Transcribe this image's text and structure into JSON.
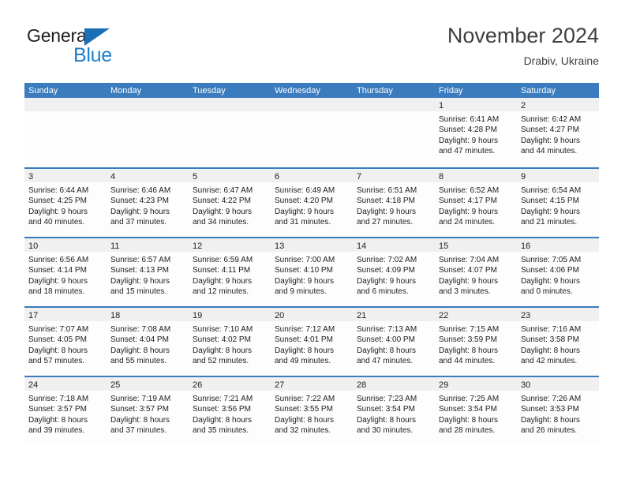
{
  "brand": {
    "name_part1": "General",
    "name_part2": "Blue",
    "logo_icon": "triangle-logo-icon",
    "colors": {
      "blue": "#1a7fd0",
      "triangle_blue": "#1a6fb5",
      "dark": "#231f20"
    }
  },
  "header": {
    "title": "November 2024",
    "subtitle": "Drabiv, Ukraine"
  },
  "theme": {
    "header_blue": "#3a7cbe",
    "daynum_band": "#f0f0f0",
    "cell_background": "#fdfdfd",
    "text": "#1d1d1d"
  },
  "calendar": {
    "weekdays": [
      "Sunday",
      "Monday",
      "Tuesday",
      "Wednesday",
      "Thursday",
      "Friday",
      "Saturday"
    ],
    "weeks": [
      [
        {
          "day": "",
          "lines": []
        },
        {
          "day": "",
          "lines": []
        },
        {
          "day": "",
          "lines": []
        },
        {
          "day": "",
          "lines": []
        },
        {
          "day": "",
          "lines": []
        },
        {
          "day": "1",
          "lines": [
            "Sunrise: 6:41 AM",
            "Sunset: 4:28 PM",
            "Daylight: 9 hours",
            "and 47 minutes."
          ]
        },
        {
          "day": "2",
          "lines": [
            "Sunrise: 6:42 AM",
            "Sunset: 4:27 PM",
            "Daylight: 9 hours",
            "and 44 minutes."
          ]
        }
      ],
      [
        {
          "day": "3",
          "lines": [
            "Sunrise: 6:44 AM",
            "Sunset: 4:25 PM",
            "Daylight: 9 hours",
            "and 40 minutes."
          ]
        },
        {
          "day": "4",
          "lines": [
            "Sunrise: 6:46 AM",
            "Sunset: 4:23 PM",
            "Daylight: 9 hours",
            "and 37 minutes."
          ]
        },
        {
          "day": "5",
          "lines": [
            "Sunrise: 6:47 AM",
            "Sunset: 4:22 PM",
            "Daylight: 9 hours",
            "and 34 minutes."
          ]
        },
        {
          "day": "6",
          "lines": [
            "Sunrise: 6:49 AM",
            "Sunset: 4:20 PM",
            "Daylight: 9 hours",
            "and 31 minutes."
          ]
        },
        {
          "day": "7",
          "lines": [
            "Sunrise: 6:51 AM",
            "Sunset: 4:18 PM",
            "Daylight: 9 hours",
            "and 27 minutes."
          ]
        },
        {
          "day": "8",
          "lines": [
            "Sunrise: 6:52 AM",
            "Sunset: 4:17 PM",
            "Daylight: 9 hours",
            "and 24 minutes."
          ]
        },
        {
          "day": "9",
          "lines": [
            "Sunrise: 6:54 AM",
            "Sunset: 4:15 PM",
            "Daylight: 9 hours",
            "and 21 minutes."
          ]
        }
      ],
      [
        {
          "day": "10",
          "lines": [
            "Sunrise: 6:56 AM",
            "Sunset: 4:14 PM",
            "Daylight: 9 hours",
            "and 18 minutes."
          ]
        },
        {
          "day": "11",
          "lines": [
            "Sunrise: 6:57 AM",
            "Sunset: 4:13 PM",
            "Daylight: 9 hours",
            "and 15 minutes."
          ]
        },
        {
          "day": "12",
          "lines": [
            "Sunrise: 6:59 AM",
            "Sunset: 4:11 PM",
            "Daylight: 9 hours",
            "and 12 minutes."
          ]
        },
        {
          "day": "13",
          "lines": [
            "Sunrise: 7:00 AM",
            "Sunset: 4:10 PM",
            "Daylight: 9 hours",
            "and 9 minutes."
          ]
        },
        {
          "day": "14",
          "lines": [
            "Sunrise: 7:02 AM",
            "Sunset: 4:09 PM",
            "Daylight: 9 hours",
            "and 6 minutes."
          ]
        },
        {
          "day": "15",
          "lines": [
            "Sunrise: 7:04 AM",
            "Sunset: 4:07 PM",
            "Daylight: 9 hours",
            "and 3 minutes."
          ]
        },
        {
          "day": "16",
          "lines": [
            "Sunrise: 7:05 AM",
            "Sunset: 4:06 PM",
            "Daylight: 9 hours",
            "and 0 minutes."
          ]
        }
      ],
      [
        {
          "day": "17",
          "lines": [
            "Sunrise: 7:07 AM",
            "Sunset: 4:05 PM",
            "Daylight: 8 hours",
            "and 57 minutes."
          ]
        },
        {
          "day": "18",
          "lines": [
            "Sunrise: 7:08 AM",
            "Sunset: 4:04 PM",
            "Daylight: 8 hours",
            "and 55 minutes."
          ]
        },
        {
          "day": "19",
          "lines": [
            "Sunrise: 7:10 AM",
            "Sunset: 4:02 PM",
            "Daylight: 8 hours",
            "and 52 minutes."
          ]
        },
        {
          "day": "20",
          "lines": [
            "Sunrise: 7:12 AM",
            "Sunset: 4:01 PM",
            "Daylight: 8 hours",
            "and 49 minutes."
          ]
        },
        {
          "day": "21",
          "lines": [
            "Sunrise: 7:13 AM",
            "Sunset: 4:00 PM",
            "Daylight: 8 hours",
            "and 47 minutes."
          ]
        },
        {
          "day": "22",
          "lines": [
            "Sunrise: 7:15 AM",
            "Sunset: 3:59 PM",
            "Daylight: 8 hours",
            "and 44 minutes."
          ]
        },
        {
          "day": "23",
          "lines": [
            "Sunrise: 7:16 AM",
            "Sunset: 3:58 PM",
            "Daylight: 8 hours",
            "and 42 minutes."
          ]
        }
      ],
      [
        {
          "day": "24",
          "lines": [
            "Sunrise: 7:18 AM",
            "Sunset: 3:57 PM",
            "Daylight: 8 hours",
            "and 39 minutes."
          ]
        },
        {
          "day": "25",
          "lines": [
            "Sunrise: 7:19 AM",
            "Sunset: 3:57 PM",
            "Daylight: 8 hours",
            "and 37 minutes."
          ]
        },
        {
          "day": "26",
          "lines": [
            "Sunrise: 7:21 AM",
            "Sunset: 3:56 PM",
            "Daylight: 8 hours",
            "and 35 minutes."
          ]
        },
        {
          "day": "27",
          "lines": [
            "Sunrise: 7:22 AM",
            "Sunset: 3:55 PM",
            "Daylight: 8 hours",
            "and 32 minutes."
          ]
        },
        {
          "day": "28",
          "lines": [
            "Sunrise: 7:23 AM",
            "Sunset: 3:54 PM",
            "Daylight: 8 hours",
            "and 30 minutes."
          ]
        },
        {
          "day": "29",
          "lines": [
            "Sunrise: 7:25 AM",
            "Sunset: 3:54 PM",
            "Daylight: 8 hours",
            "and 28 minutes."
          ]
        },
        {
          "day": "30",
          "lines": [
            "Sunrise: 7:26 AM",
            "Sunset: 3:53 PM",
            "Daylight: 8 hours",
            "and 26 minutes."
          ]
        }
      ]
    ]
  }
}
